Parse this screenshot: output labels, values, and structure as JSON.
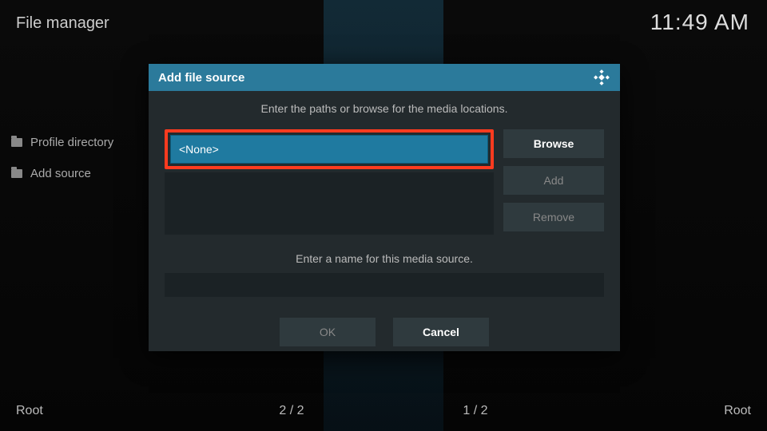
{
  "header": {
    "title": "File manager",
    "clock": "11:49 AM"
  },
  "sidebar": {
    "items": [
      {
        "label": "Profile directory"
      },
      {
        "label": "Add source"
      }
    ]
  },
  "dialog": {
    "title": "Add file source",
    "path_instruction": "Enter the paths or browse for the media locations.",
    "path_value": "<None>",
    "browse_label": "Browse",
    "add_label": "Add",
    "remove_label": "Remove",
    "name_instruction": "Enter a name for this media source.",
    "name_value": "",
    "ok_label": "OK",
    "cancel_label": "Cancel"
  },
  "footer": {
    "left_root": "Root",
    "left_count": "2 / 2",
    "right_count": "1 / 2",
    "right_root": "Root"
  }
}
